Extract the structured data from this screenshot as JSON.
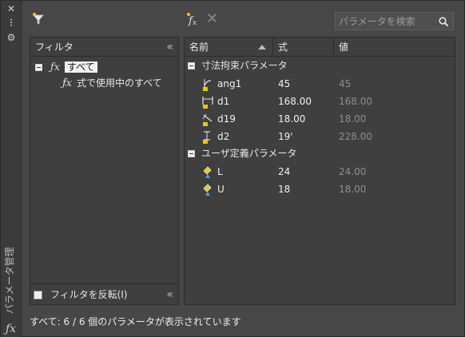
{
  "strip": {
    "title": "パラメータ管理",
    "close_glyph": "✕",
    "autohide_glyph": "⫶",
    "props_glyph": "⚙",
    "fx_glyph": "ƒx"
  },
  "toolbar": {
    "search_placeholder": "パラメータを検索",
    "delete_glyph": "✕"
  },
  "filter": {
    "header": "フィルタ",
    "collapse_glyph": "«",
    "tree": {
      "all_label": "すべて",
      "used_label": "式で使用中のすべて",
      "fx_glyph": "ƒx"
    },
    "invert_label": "フィルタを反転(I)"
  },
  "grid": {
    "columns": {
      "name": "名前",
      "expression": "式",
      "value": "値"
    },
    "groups": [
      {
        "label": "寸法拘束パラメータ",
        "rows": [
          {
            "icon": "angular-constraint-icon",
            "name": "ang1",
            "expression": "45",
            "value": "45"
          },
          {
            "icon": "horizontal-constraint-icon",
            "name": "d1",
            "expression": "168.00",
            "value": "168.00"
          },
          {
            "icon": "aligned-constraint-icon",
            "name": "d19",
            "expression": "18.00",
            "value": "18.00"
          },
          {
            "icon": "vertical-constraint-icon",
            "name": "d2",
            "expression": "19'",
            "value": "228.00"
          }
        ]
      },
      {
        "label": "ユーザ定義パラメータ",
        "rows": [
          {
            "icon": "user-parameter-icon",
            "name": "L",
            "expression": "24",
            "value": "24.00"
          },
          {
            "icon": "user-parameter-icon",
            "name": "U",
            "expression": "18",
            "value": "18.00"
          }
        ]
      }
    ]
  },
  "status": "すべて: 6 / 6 個のパラメータが表示されています",
  "colors": {
    "background": "#474747",
    "panel": "#3f3f3f",
    "lock_yellow": "#f0c419",
    "value_gray": "#8e8e8e"
  }
}
